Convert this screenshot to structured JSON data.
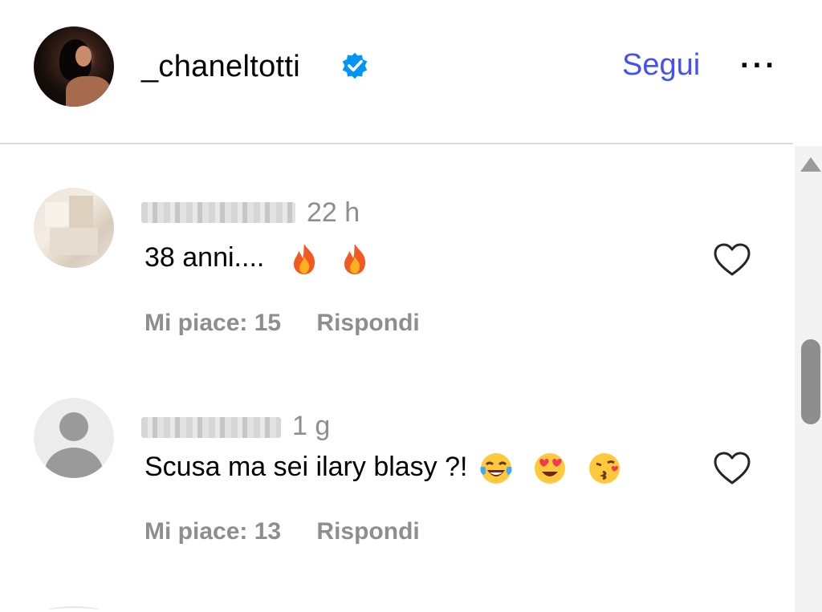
{
  "header": {
    "username": "_chaneltotti",
    "follow_label": "Segui",
    "more_label": "···",
    "verified_icon": "verified-badge-icon"
  },
  "colors": {
    "accent": "#4150f7",
    "muted": "#8e8e8e",
    "verified": "#0095f6"
  },
  "comments": [
    {
      "time": "22 h",
      "text": "38 anni....",
      "emojis": [
        "fire",
        "fire"
      ],
      "likes_label": "Mi piace: 15",
      "reply_label": "Rispondi"
    },
    {
      "time": "1 g",
      "text": "Scusa ma sei ilary blasy ?!",
      "emojis": [
        "tears-of-joy",
        "heart-eyes",
        "kissing-face"
      ],
      "likes_label": "Mi piace: 13",
      "reply_label": "Rispondi"
    }
  ]
}
